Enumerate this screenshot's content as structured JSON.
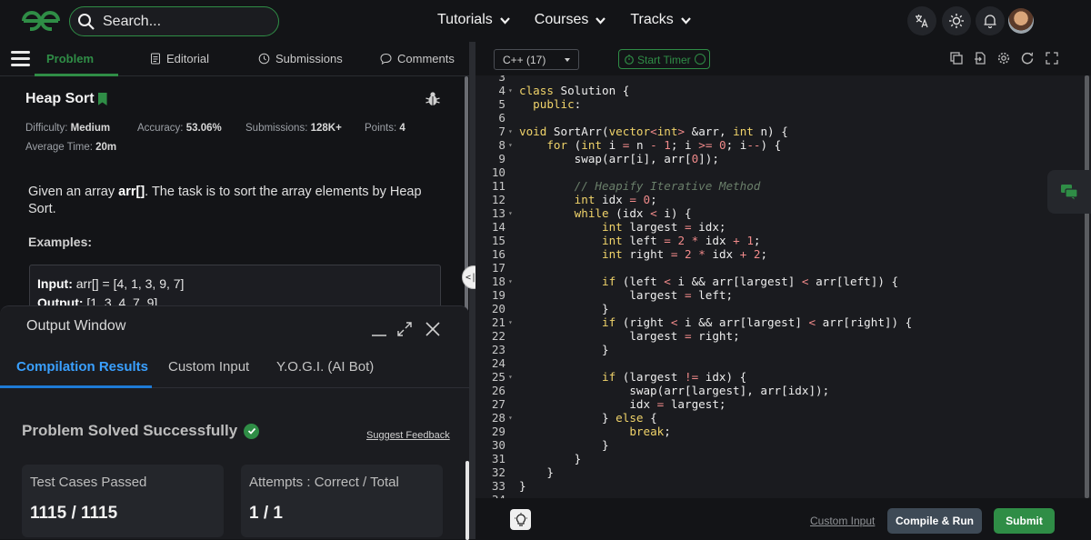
{
  "nav": {
    "search_placeholder": "Search...",
    "links": [
      "Tutorials",
      "Courses",
      "Tracks"
    ]
  },
  "problem_tabs": [
    "Problem",
    "Editorial",
    "Submissions",
    "Comments"
  ],
  "problem": {
    "title": "Heap Sort",
    "difficulty_label": "Difficulty:",
    "difficulty": "Medium",
    "accuracy_label": "Accuracy:",
    "accuracy": "53.06%",
    "submissions_label": "Submissions:",
    "submissions": "128K+",
    "points_label": "Points:",
    "points": "4",
    "avg_time_label": "Average Time:",
    "avg_time": "20m",
    "desc_pre": "Given an array ",
    "desc_bold": "arr[]",
    "desc_post": ". The task is to sort the array elements by Heap Sort.",
    "examples_label": "Examples:",
    "ex_input_label": "Input:",
    "ex_input": " arr[] = [4, 1, 3, 9, 7]",
    "ex_output_label": "Output:",
    "ex_output": " [1, 3, 4, 7, 9]"
  },
  "output": {
    "title": "Output Window",
    "tabs": [
      "Compilation Results",
      "Custom Input",
      "Y.O.G.I. (AI Bot)"
    ],
    "status": "Problem Solved Successfully",
    "suggest": "Suggest Feedback",
    "card1_title": "Test Cases Passed",
    "card1_value": "1115 / 1115",
    "card2_title": "Attempts : Correct / Total",
    "card2_value": "1 / 1"
  },
  "editor": {
    "language": "C++ (17)",
    "timer": "Start Timer",
    "custom_input": "Custom Input",
    "compile": "Compile & Run",
    "submit": "Submit",
    "line_numbers": [
      "3",
      "4",
      "5",
      "6",
      "7",
      "8",
      "9",
      "10",
      "11",
      "12",
      "13",
      "14",
      "15",
      "16",
      "17",
      "18",
      "19",
      "20",
      "21",
      "22",
      "23",
      "24",
      "25",
      "26",
      "27",
      "28",
      "29",
      "30",
      "31",
      "32",
      "33",
      "34"
    ],
    "code_lines": [
      "",
      "class Solution {",
      "  public:",
      "",
      "void SortArr(vector<int> &arr, int n) {",
      "    for (int i = n - 1; i >= 0; i--) {",
      "        swap(arr[i], arr[0]);",
      "",
      "        // Heapify Iterative Method",
      "        int idx = 0;",
      "        while (idx < i) {",
      "            int largest = idx;",
      "            int left = 2 * idx + 1;",
      "            int right = 2 * idx + 2;",
      "",
      "            if (left < i && arr[largest] < arr[left]) {",
      "                largest = left;",
      "            }",
      "            if (right < i && arr[largest] < arr[right]) {",
      "                largest = right;",
      "            }",
      "",
      "            if (largest != idx) {",
      "                swap(arr[largest], arr[idx]);",
      "                idx = largest;",
      "            } else {",
      "                break;",
      "            }",
      "        }",
      "    }",
      "}",
      ""
    ],
    "fold_lines": [
      "4",
      "7",
      "8",
      "13",
      "18",
      "21",
      "25",
      "28"
    ]
  }
}
